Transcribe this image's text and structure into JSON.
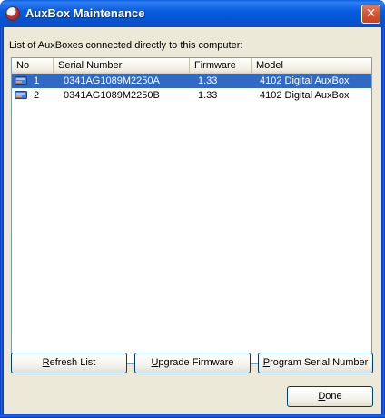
{
  "window": {
    "title": "AuxBox Maintenance",
    "close_label": "✕"
  },
  "list_label": "List of AuxBoxes connected directly to this computer:",
  "columns": [
    "No",
    "Serial Number",
    "Firmware",
    "Model"
  ],
  "rows": [
    {
      "no": "1",
      "serial": "0341AG1089M2250A",
      "firmware": "1.33",
      "model": "4102 Digital AuxBox",
      "selected": true,
      "icon": "auxbox-device-icon"
    },
    {
      "no": "2",
      "serial": "0341AG1089M2250B",
      "firmware": "1.33",
      "model": "4102 Digital AuxBox",
      "selected": false,
      "icon": "auxbox-device-icon"
    }
  ],
  "buttons": {
    "refresh": {
      "mnemonic": "R",
      "rest": "efresh List"
    },
    "upgrade": {
      "mnemonic": "U",
      "rest": "pgrade Firmware"
    },
    "program": {
      "mnemonic": "P",
      "rest": "rogram Serial Number"
    },
    "done": {
      "mnemonic": "D",
      "rest": "one"
    }
  },
  "colors": {
    "selection": "#316ac5",
    "titlebar": "#0a5ddf",
    "dialog_bg": "#ece9d8"
  }
}
